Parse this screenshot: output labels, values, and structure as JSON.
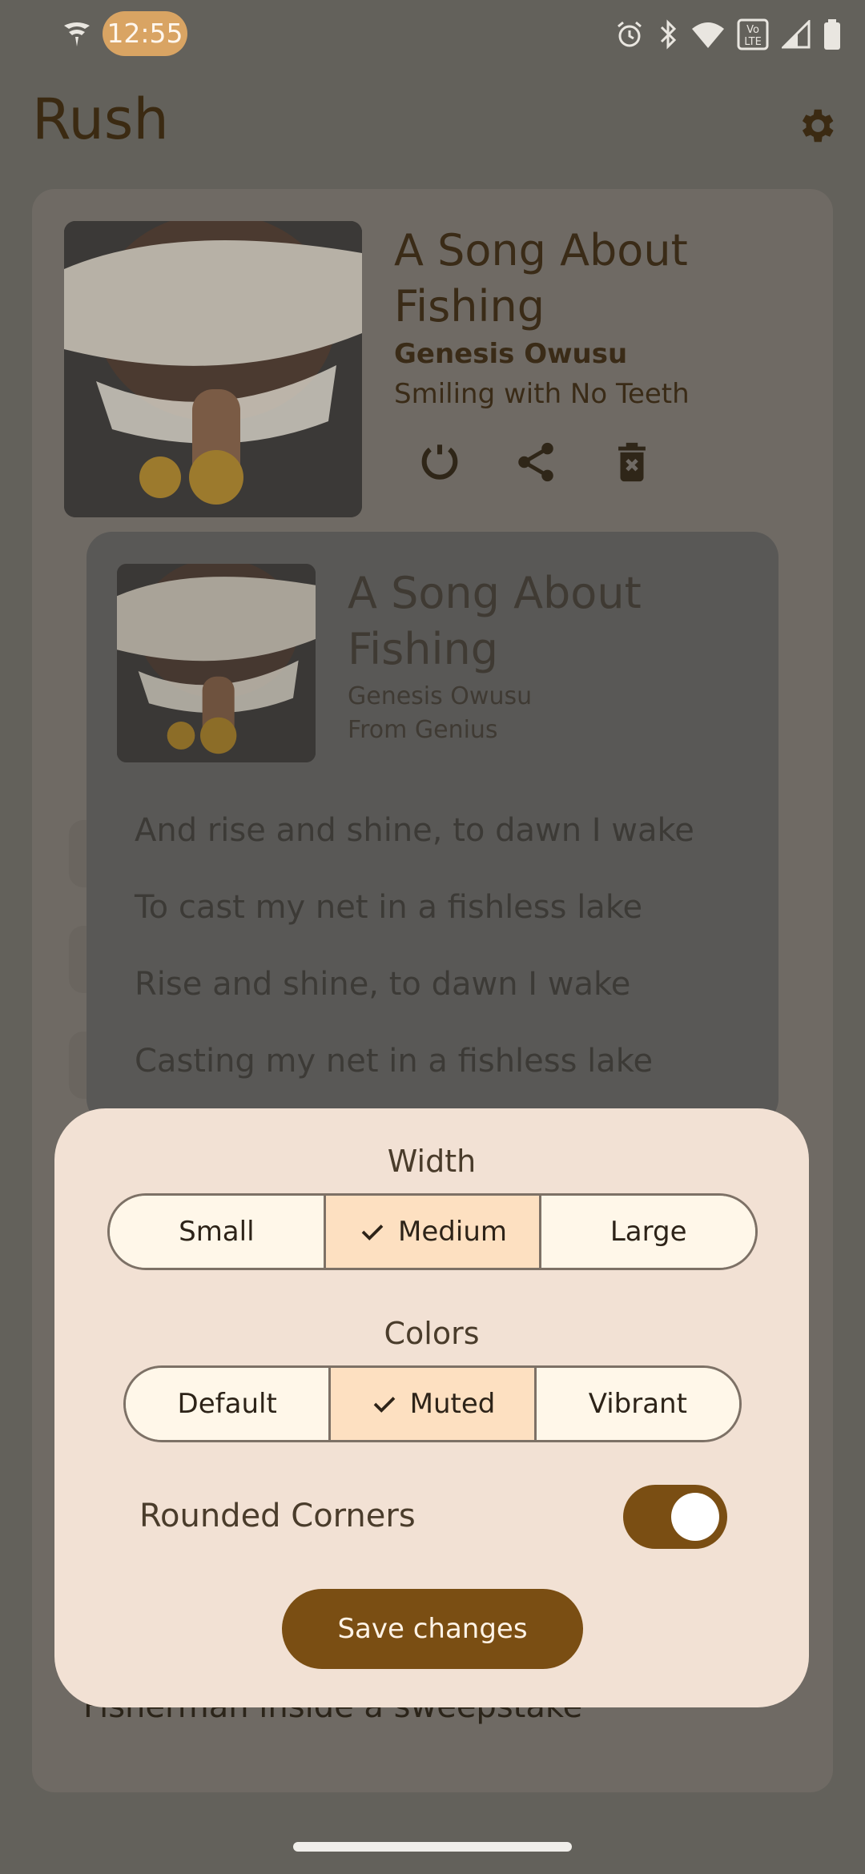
{
  "status_bar": {
    "time": "12:55"
  },
  "app": {
    "title": "Rush"
  },
  "now_playing": {
    "title": "A Song About Fishing",
    "artist": "Genesis Owusu",
    "album": "Smiling with No Teeth"
  },
  "lyrics_card": {
    "title": "A Song About Fishing",
    "artist": "Genesis Owusu",
    "source": "From Genius",
    "lines": [
      "And rise and shine, to dawn I wake",
      "To cast my net in a fishless lake",
      "Rise and shine, to dawn I wake",
      "Casting my net in a fishless lake"
    ]
  },
  "background_text": "Fisherman inside a sweepstake",
  "sheet": {
    "width_label": "Width",
    "width_options": [
      "Small",
      "Medium",
      "Large"
    ],
    "width_selected": "Medium",
    "colors_label": "Colors",
    "color_options": [
      "Default",
      "Muted",
      "Vibrant"
    ],
    "color_selected": "Muted",
    "rounded_label": "Rounded Corners",
    "rounded_enabled": true,
    "save_label": "Save changes"
  },
  "colors": {
    "accent": "#7a4e13",
    "sheet_bg": "#f2e1d4",
    "selected_bg": "#fde0c1"
  }
}
